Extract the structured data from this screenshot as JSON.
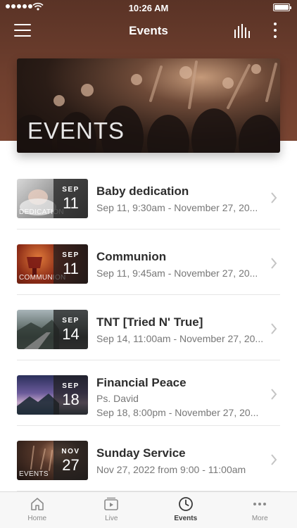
{
  "status_bar": {
    "time": "10:26 AM",
    "signal_icon": "signal-dots-icon",
    "wifi_icon": "wifi-icon",
    "battery_icon": "battery-icon"
  },
  "nav": {
    "title": "Events",
    "menu_icon": "hamburger-menu-icon",
    "bars_icon": "audio-bars-icon",
    "more_icon": "vertical-dots-icon"
  },
  "banner": {
    "title": "EVENTS"
  },
  "events": [
    {
      "title": "Baby dedication",
      "subtitle": "Sep 11, 9:30am - November 27, 20...",
      "month": "SEP",
      "day": "11",
      "caption": "DEDICATION"
    },
    {
      "title": "Communion",
      "subtitle": "Sep 11, 9:45am - November 27, 20...",
      "month": "SEP",
      "day": "11",
      "caption": "COMMUNION"
    },
    {
      "title": "TNT [Tried N' True]",
      "subtitle": "Sep 14, 11:00am - November 27, 20...",
      "month": "SEP",
      "day": "14",
      "caption": ""
    },
    {
      "title": "Financial Peace",
      "subtitle_1": "Ps. David",
      "subtitle": "Sep 18, 8:00pm - November 27, 20...",
      "month": "SEP",
      "day": "18",
      "caption": ""
    },
    {
      "title": "Sunday Service",
      "subtitle": "Nov 27, 2022 from 9:00 - 11:00am",
      "month": "NOV",
      "day": "27",
      "caption": "EVENTS"
    }
  ],
  "tabs": [
    {
      "label": "Home",
      "icon": "home-icon",
      "active": false
    },
    {
      "label": "Live",
      "icon": "play-icon",
      "active": false
    },
    {
      "label": "Events",
      "icon": "clock-icon",
      "active": true
    },
    {
      "label": "More",
      "icon": "more-dots-icon",
      "active": false
    }
  ],
  "colors": {
    "header": "#6f3f2e",
    "active_tab": "#3a3a3a",
    "inactive_tab": "#8a8a8a"
  }
}
